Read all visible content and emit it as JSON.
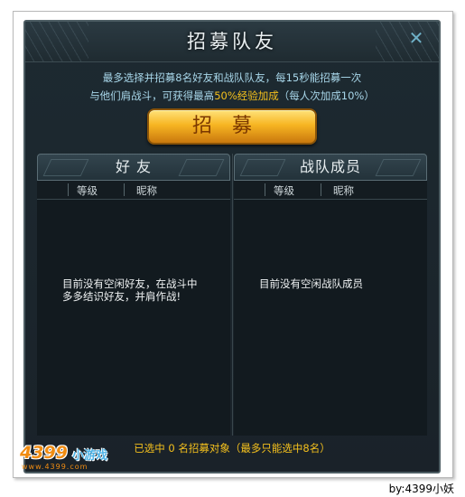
{
  "dialog": {
    "title": "招募队友",
    "close_glyph": "✕"
  },
  "info": {
    "line1": "最多选择并招募8名好友和战队队友，每15秒能招募一次",
    "line2_prefix": "与他们肩战斗，可获得最高",
    "line2_highlight": "50%经验加成",
    "line2_suffix": "（每人次加成10%）"
  },
  "recruit_button": {
    "label": "招募"
  },
  "friends": {
    "header": "好 友",
    "col_level": "等级",
    "col_nick": "昵称",
    "empty_message": "目前没有空闲好友，在战斗中多多结识好友，并肩作战!"
  },
  "team": {
    "header": "战队成员",
    "col_level": "等级",
    "col_nick": "昵称",
    "empty_message": "目前没有空闲战队成员"
  },
  "status": {
    "selected_text": "已选中 0 名招募对象（最多只能选中8名）"
  },
  "watermark": {
    "logo_number": "4399",
    "logo_game": "小游戏",
    "logo_url": "www.4399.com",
    "credit": "by:4399小妖"
  },
  "colors": {
    "accent_gold": "#f4c01d",
    "info_text": "#a8d7ea",
    "panel_bg": "#1a2229"
  }
}
